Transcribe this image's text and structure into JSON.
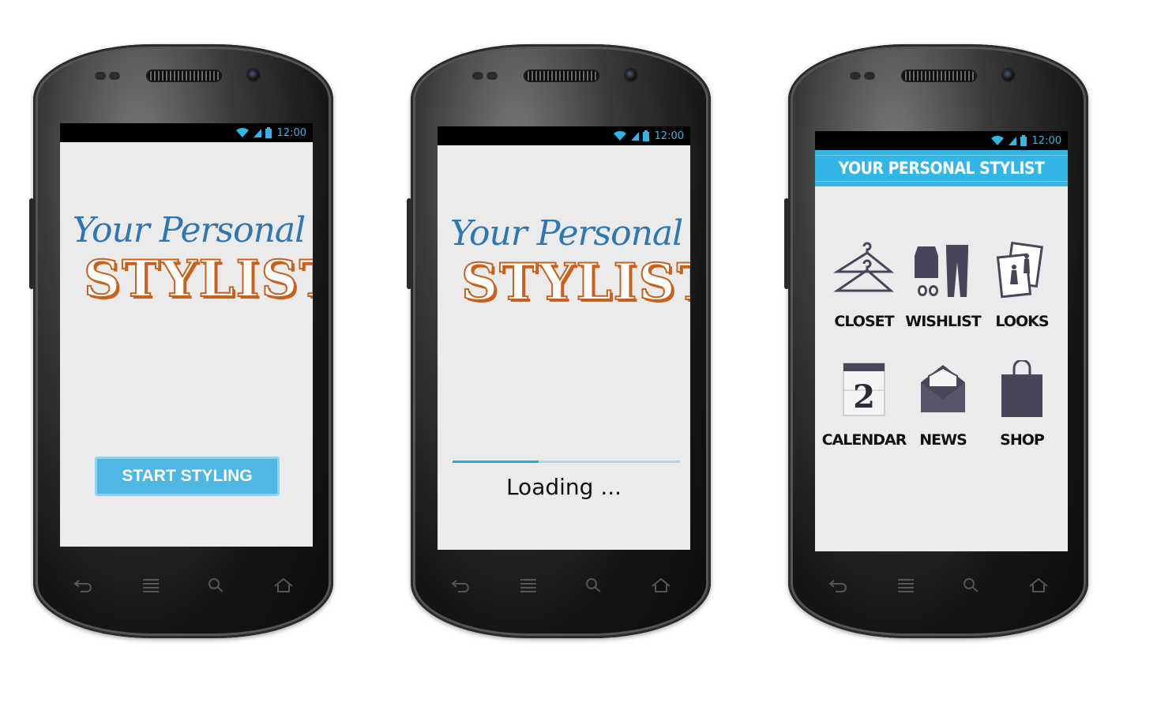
{
  "status": {
    "time": "12:00"
  },
  "screen1": {
    "logo_line1": "Your Personal",
    "logo_line2": "STYLIST",
    "start_button": "START STYLING"
  },
  "screen2": {
    "logo_line1": "Your Personal",
    "logo_line2": "STYLIST",
    "loading": "Loading ...",
    "progress_fraction": 0.38
  },
  "screen3": {
    "title": "YOUR PERSONAL STYLIST",
    "tiles": [
      {
        "label": "CLOSET",
        "icon": "hanger-icon"
      },
      {
        "label": "WISHLIST",
        "icon": "outfit-icon"
      },
      {
        "label": "LOOKS",
        "icon": "photos-icon"
      },
      {
        "label": "CALENDAR",
        "icon": "calendar-icon"
      },
      {
        "label": "NEWS",
        "icon": "envelope-icon"
      },
      {
        "label": "SHOP",
        "icon": "shopping-bag-icon"
      }
    ]
  },
  "colors": {
    "accent": "#33b5e5",
    "logo_blue": "#2f77b4",
    "logo_orange": "#c8611d",
    "icon_dark": "#4a4558"
  }
}
